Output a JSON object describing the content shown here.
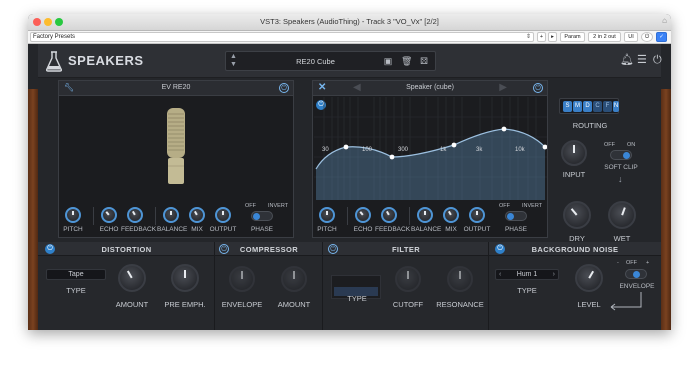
{
  "window": {
    "title": "VST3: Speakers (AudioThing) - Track 3 \"VO_Vx\" [2/2]"
  },
  "host": {
    "preset_value": "Factory Presets",
    "param_label": "Param",
    "io_label": "2 in 2 out",
    "ui_label": "UI",
    "plus_label": "+",
    "arrow_label": "▸"
  },
  "header": {
    "brand": "SPEAKERS",
    "preset_name": "RE20 Cube"
  },
  "mic_panel": {
    "title": "EV RE20",
    "knobs": [
      "PITCH",
      "ECHO",
      "FEEDBACK",
      "BALANCE",
      "MIX",
      "OUTPUT"
    ],
    "phase": {
      "off": "OFF",
      "invert": "INVERT",
      "label": "PHASE"
    }
  },
  "speaker_panel": {
    "title": "Speaker (cube)",
    "freq_labels": [
      "30",
      "100",
      "300",
      "1k",
      "3k",
      "10k"
    ],
    "knobs": [
      "PITCH",
      "ECHO",
      "FEEDBACK",
      "BALANCE",
      "MIX",
      "OUTPUT"
    ],
    "phase": {
      "off": "OFF",
      "invert": "INVERT",
      "label": "PHASE"
    }
  },
  "right": {
    "routing_buttons": [
      "S",
      "M",
      "D",
      "C",
      "F",
      "N"
    ],
    "routing_label": "ROUTING",
    "input_label": "INPUT",
    "off": "OFF",
    "on": "ON",
    "soft_clip": "SOFT CLIP",
    "dry": "DRY",
    "wet": "WET"
  },
  "distortion": {
    "title": "DISTORTION",
    "type_value": "Tape",
    "type_label": "TYPE",
    "amount": "AMOUNT",
    "pre_emph": "PRE EMPH."
  },
  "compressor": {
    "title": "COMPRESSOR",
    "envelope": "ENVELOPE",
    "amount": "AMOUNT"
  },
  "filter": {
    "title": "FILTER",
    "type_label": "TYPE",
    "cutoff": "CUTOFF",
    "resonance": "RESONANCE"
  },
  "noise": {
    "title": "BACKGROUND NOISE",
    "type_value": "Hum 1",
    "type_label": "TYPE",
    "level": "LEVEL",
    "off": "OFF",
    "plus": "+",
    "minus": "-",
    "envelope": "ENVELOPE"
  },
  "colors": {
    "accent": "#3a86d6",
    "panel": "#1b1c1f",
    "background": "#24262a"
  }
}
